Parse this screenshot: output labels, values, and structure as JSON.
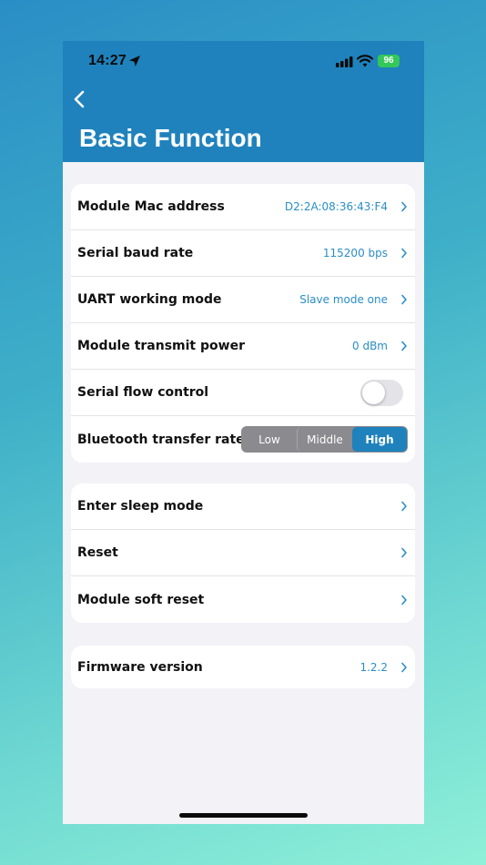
{
  "status_bar": {
    "time": "14:27",
    "battery": "96"
  },
  "header": {
    "title": "Basic Function"
  },
  "settings_group": {
    "items": [
      {
        "label": "Module Mac address",
        "value": "D2:2A:08:36:43:F4"
      },
      {
        "label": "Serial baud rate",
        "value": "115200 bps"
      },
      {
        "label": "UART working mode",
        "value": "Slave mode one"
      },
      {
        "label": "Module transmit power",
        "value": "0 dBm"
      }
    ],
    "flow_control": {
      "label": "Serial flow control",
      "enabled": false
    },
    "transfer_rate": {
      "label": "Bluetooth transfer rate",
      "options": [
        "Low",
        "Middle",
        "High"
      ],
      "selected": "High"
    }
  },
  "actions_group": {
    "items": [
      {
        "label": "Enter sleep mode"
      },
      {
        "label": "Reset"
      },
      {
        "label": "Module soft reset"
      }
    ]
  },
  "firmware": {
    "label": "Firmware version",
    "value": "1.2.2"
  },
  "colors": {
    "accent": "#1f82bc",
    "value_text": "#2a8ec6",
    "background": "#f2f2f7"
  }
}
